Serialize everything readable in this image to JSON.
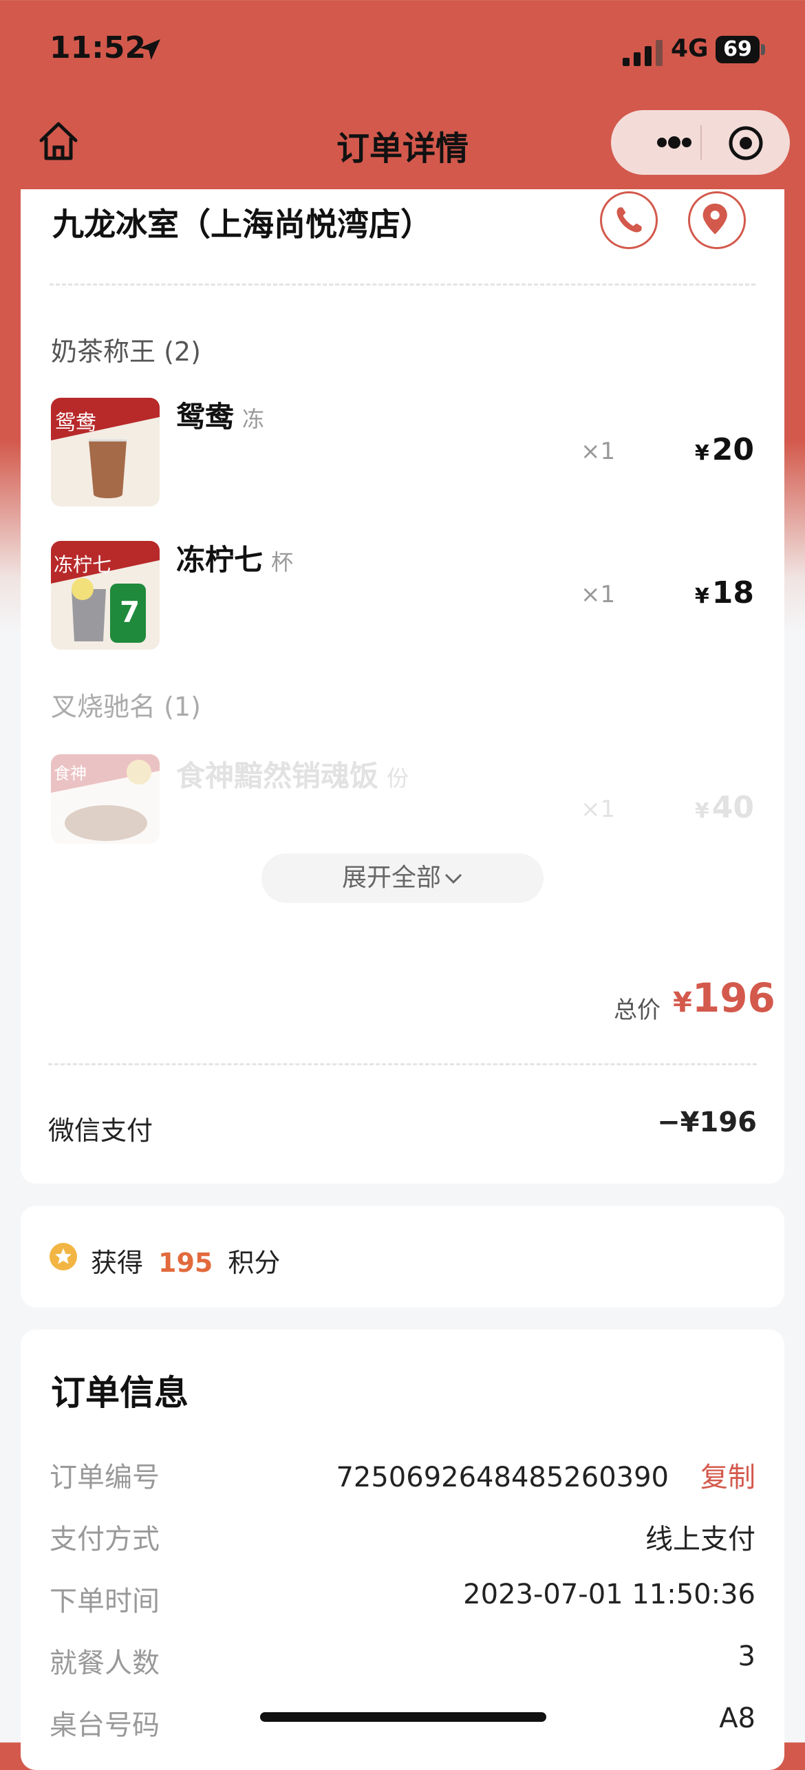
{
  "status_bar": {
    "time": "11:52",
    "network": "4G",
    "battery": "69"
  },
  "nav": {
    "title": "订单详情"
  },
  "store": {
    "name": "九龙冰室（上海尚悦湾店）"
  },
  "categories": [
    {
      "label": "奶茶称王 (2)",
      "items": [
        {
          "img_text": "鸳鸯",
          "name": "鸳鸯",
          "unit": "冻",
          "qty": "×1",
          "currency": "¥",
          "price": "20"
        },
        {
          "img_text": "冻柠七",
          "name": "冻柠七",
          "unit": "杯",
          "qty": "×1",
          "currency": "¥",
          "price": "18"
        }
      ]
    },
    {
      "label": "叉烧驰名 (1)",
      "items": [
        {
          "img_text": "食神",
          "name": "食神黯然销魂饭",
          "unit": "份",
          "qty": "×1",
          "currency": "¥",
          "price": "40"
        }
      ]
    }
  ],
  "expand_label": "展开全部",
  "total": {
    "label": "总价",
    "currency": "¥",
    "value": "196"
  },
  "payment": {
    "label": "微信支付",
    "value": "−¥196"
  },
  "points": {
    "prefix": "获得",
    "value": "195",
    "suffix": "积分"
  },
  "order_info": {
    "title": "订单信息",
    "rows": [
      {
        "label": "订单编号",
        "value": "7250692648485260390",
        "action": "复制"
      },
      {
        "label": "支付方式",
        "value": "线上支付"
      },
      {
        "label": "下单时间",
        "value": "2023-07-01 11:50:36"
      },
      {
        "label": "就餐人数",
        "value": "3"
      },
      {
        "label": "桌台号码",
        "value": "A8"
      }
    ]
  },
  "colors": {
    "brand": "#d3594c",
    "points_accent": "#e26a3c"
  }
}
